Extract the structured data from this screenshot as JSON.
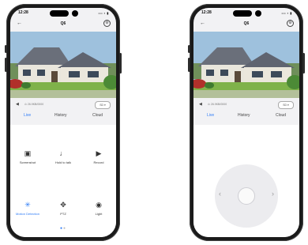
{
  "status": {
    "time": "12:28",
    "signal": "••• ▪ ▮"
  },
  "nav": {
    "back": "←",
    "title": "Q6",
    "settings": "⚙"
  },
  "infobar": {
    "speaker": "◀",
    "bitrate": "⊙ 26.9KB/0000",
    "quality": "SD ▾"
  },
  "tabs": [
    "Live",
    "History",
    "Cloud"
  ],
  "actions_row1": [
    {
      "icon": "camera-icon",
      "glyph": "▣",
      "label": "Screenshot"
    },
    {
      "icon": "microphone-icon",
      "glyph": "♩",
      "label": "Hold to talk"
    },
    {
      "icon": "video-icon",
      "glyph": "▶",
      "label": "Record"
    }
  ],
  "actions_row2": [
    {
      "icon": "running-person-icon",
      "glyph": "✳",
      "label": "Motion Detection"
    },
    {
      "icon": "ptz-icon",
      "glyph": "✥",
      "label": "PTZ"
    },
    {
      "icon": "light-icon",
      "glyph": "◉",
      "label": "Light"
    }
  ],
  "pager": {
    "on": "●",
    "off": "●"
  },
  "joystick": {
    "left": "‹",
    "right": "›"
  },
  "colors": {
    "accent": "#2e7cf6"
  }
}
